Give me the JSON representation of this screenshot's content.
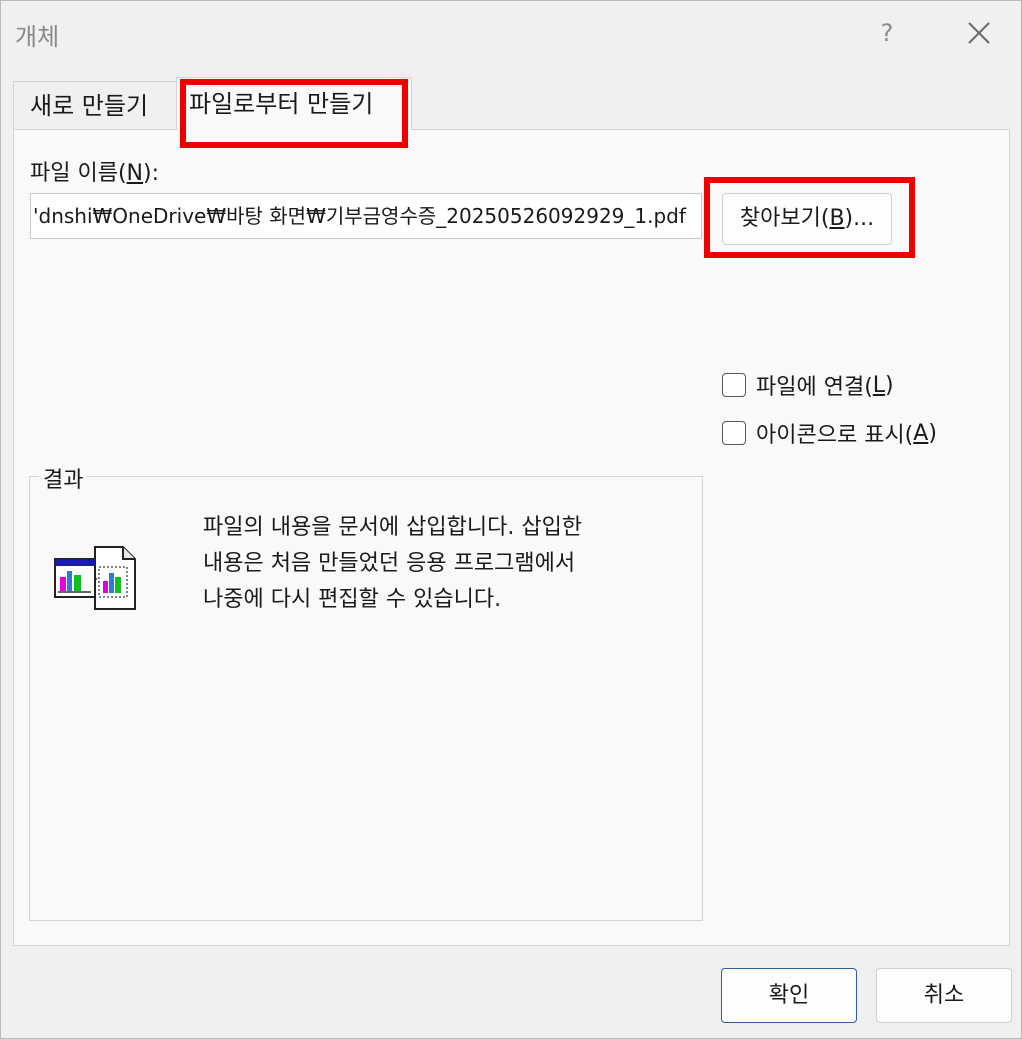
{
  "titlebar": {
    "title": "개체",
    "help_label": "?"
  },
  "tabs": [
    {
      "label": "새로 만들기",
      "selected": false
    },
    {
      "label": "파일로부터 만들기",
      "selected": true
    }
  ],
  "file": {
    "label_prefix": "파일 이름(",
    "label_mnemonic": "N",
    "label_suffix": "):",
    "value": "'dnshi₩OneDrive₩바탕 화면₩기부금영수증_20250526092929_1.pdf",
    "browse_prefix": "찾아보기(",
    "browse_mnemonic": "B",
    "browse_suffix": ")..."
  },
  "options": {
    "link_prefix": "파일에 연결(",
    "link_mnemonic": "L",
    "link_suffix": ")",
    "link_checked": false,
    "icon_prefix": "아이콘으로 표시(",
    "icon_mnemonic": "A",
    "icon_suffix": ")",
    "icon_checked": false
  },
  "result": {
    "legend": "결과",
    "text": "파일의 내용을 문서에 삽입합니다. 삽입한\n내용은 처음 만들었던 응용 프로그램에서\n나중에 다시 편집할 수 있습니다."
  },
  "buttons": {
    "ok": "확인",
    "cancel": "취소"
  },
  "icons": {
    "close": "close-icon",
    "result": "embedded-document-icon",
    "checkbox": "checkbox-icon"
  },
  "colors": {
    "highlight": "#ee0000",
    "default_button_border": "#2f5fa3"
  }
}
